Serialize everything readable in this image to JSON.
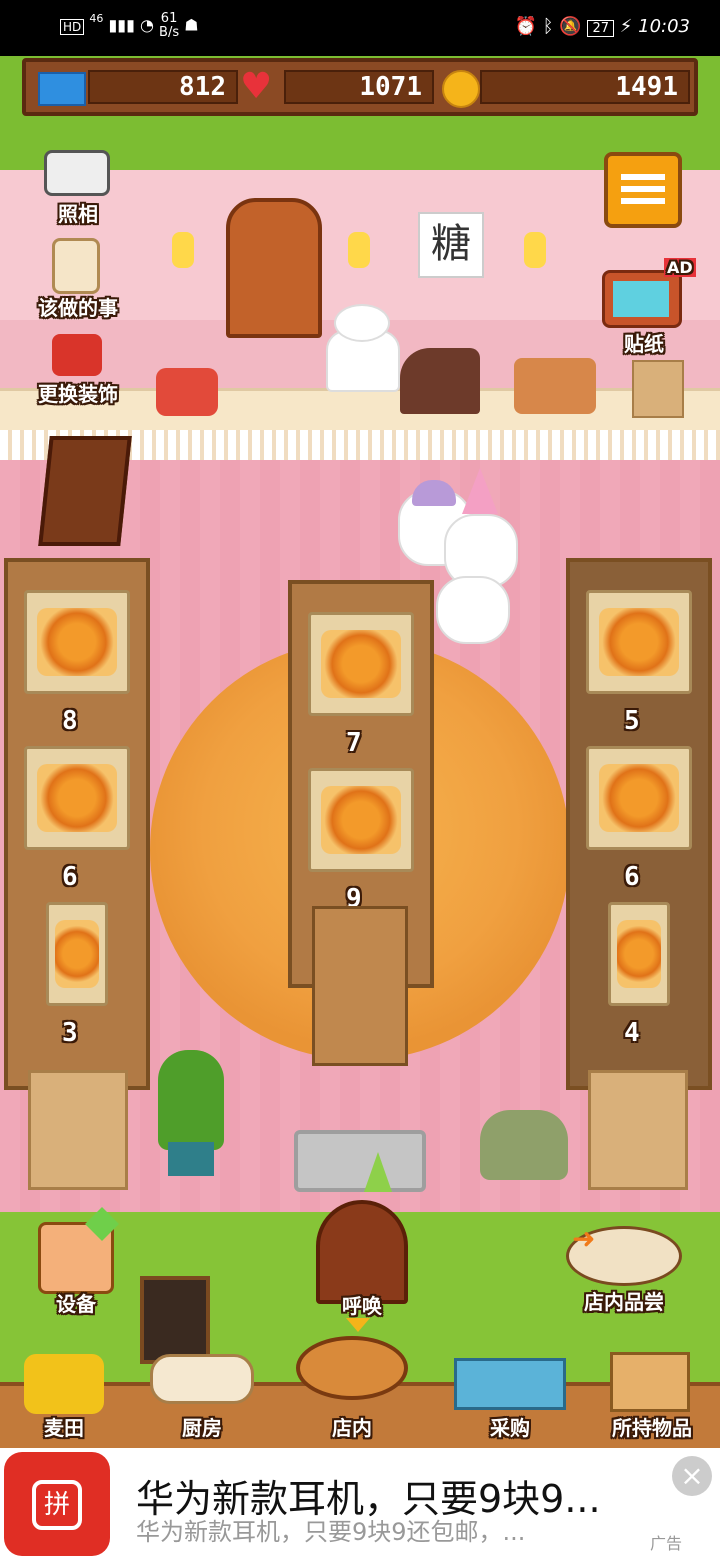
{
  "status_bar": {
    "net_type": "HD",
    "signal": "46",
    "speed_value": "61",
    "speed_unit": "B/s",
    "battery": "27",
    "time": "10:03"
  },
  "resources": {
    "tickets": "812",
    "hearts": "1071",
    "coins": "1491"
  },
  "shop": {
    "sign_char": "糖",
    "tv_badge": "AD"
  },
  "left_menu": {
    "photo": "照相",
    "todo": "该做的事",
    "decor": "更换装饰"
  },
  "right_menu": {
    "stickers": "贴纸"
  },
  "tables": {
    "left": [
      "8",
      "6",
      "3"
    ],
    "middle": [
      "7",
      "9"
    ],
    "right": [
      "5",
      "6",
      "4"
    ]
  },
  "bottom_actions": {
    "equipment": "设备",
    "summon": "呼唤",
    "tasting": "店内品尝"
  },
  "nav": {
    "wheat_field": "麦田",
    "kitchen": "厨房",
    "shop": "店内",
    "purchase": "采购",
    "inventory": "所持物品"
  },
  "ad": {
    "title": "华为新款耳机，只要9块9...",
    "subtitle": "华为新款耳机，只要9块9还包邮，...",
    "tag": "广告",
    "logo_char": "拼"
  },
  "colors": {
    "grass": "#6fae2e",
    "wall": "#f7c9d1",
    "floor": "#f0a8b8",
    "wood": "#b17a45",
    "coin": "#f5b41a",
    "heart": "#e8323a"
  }
}
